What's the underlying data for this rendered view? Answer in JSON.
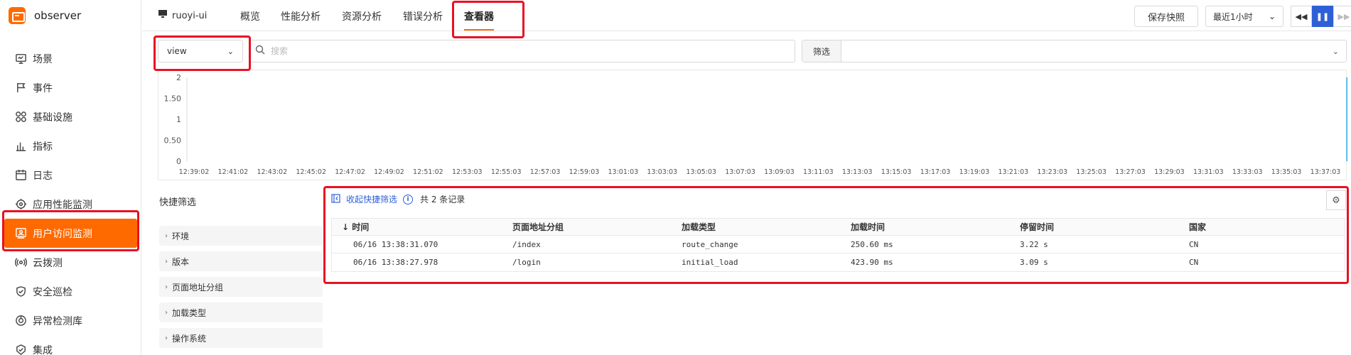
{
  "brand": {
    "name": "observer"
  },
  "sidebar": {
    "items": [
      {
        "label": "场景",
        "icon": "monitor-icon"
      },
      {
        "label": "事件",
        "icon": "flag-icon"
      },
      {
        "label": "基础设施",
        "icon": "grid-circles-icon"
      },
      {
        "label": "指标",
        "icon": "bar-chart-icon"
      },
      {
        "label": "日志",
        "icon": "calendar-icon"
      },
      {
        "label": "应用性能监测",
        "icon": "target-icon"
      },
      {
        "label": "用户访问监测",
        "icon": "user-monitor-icon",
        "active": true
      },
      {
        "label": "云拨测",
        "icon": "broadcast-icon"
      },
      {
        "label": "安全巡检",
        "icon": "shield-icon"
      },
      {
        "label": "异常检测库",
        "icon": "alert-radar-icon"
      },
      {
        "label": "集成",
        "icon": "integration-icon"
      }
    ]
  },
  "topbar": {
    "app_name": "ruoyi-ui",
    "tabs": [
      "概览",
      "性能分析",
      "资源分析",
      "错误分析",
      "查看器"
    ],
    "active_tab": "查看器",
    "save_snapshot": "保存快照",
    "time_range": "最近1小时",
    "playback": {
      "rewind": "◀◀",
      "pause": "❚❚",
      "forward": "▶▶"
    }
  },
  "search": {
    "view_value": "view",
    "placeholder": "搜索",
    "filter_label": "筛选"
  },
  "chart_data": {
    "type": "bar",
    "yticks": [
      "2",
      "1.50",
      "1",
      "0.50",
      "0"
    ],
    "ylim": [
      0,
      2
    ],
    "xticks": [
      "12:39:02",
      "12:41:02",
      "12:43:02",
      "12:45:02",
      "12:47:02",
      "12:49:02",
      "12:51:02",
      "12:53:03",
      "12:55:03",
      "12:57:03",
      "12:59:03",
      "13:01:03",
      "13:03:03",
      "13:05:03",
      "13:07:03",
      "13:09:03",
      "13:11:03",
      "13:13:03",
      "13:15:03",
      "13:17:03",
      "13:19:03",
      "13:21:03",
      "13:23:03",
      "13:25:03",
      "13:27:03",
      "13:29:03",
      "13:31:03",
      "13:33:03",
      "13:35:03",
      "13:37:03"
    ],
    "bars": [
      {
        "x_index": 29.7,
        "value": 2
      }
    ],
    "color": "#36b3f5"
  },
  "quick_filter": {
    "title": "快捷筛选",
    "items": [
      "环境",
      "版本",
      "页面地址分组",
      "加载类型",
      "操作系统"
    ]
  },
  "table": {
    "collapse_label": "收起快捷筛选",
    "total_text": "共 2 条记录",
    "columns": [
      "↓ 时间",
      "页面地址分组",
      "加载类型",
      "加载时间",
      "停留时间",
      "国家"
    ],
    "rows": [
      [
        "06/16 13:38:31.070",
        "/index",
        "route_change",
        "250.60 ms",
        "3.22 s",
        "CN"
      ],
      [
        "06/16 13:38:27.978",
        "/login",
        "initial_load",
        "423.90 ms",
        "3.09 s",
        "CN"
      ]
    ]
  },
  "colors": {
    "accent": "#ff6a00",
    "primary": "#2e5fd6",
    "annotation": "#e81123"
  }
}
